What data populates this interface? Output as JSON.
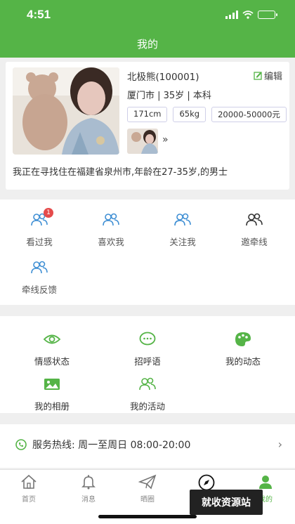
{
  "status_bar": {
    "time": "4:51"
  },
  "header": {
    "title": "我的"
  },
  "profile": {
    "name": "北极熊(100001)",
    "edit_label": "编辑",
    "info": "厦门市 | 35岁 | 本科",
    "tags": [
      "171cm",
      "65kg",
      "20000-50000元"
    ],
    "more": "»",
    "description": "我正在寻找住在福建省泉州市,年龄在27-35岁,的男士"
  },
  "quick_actions": [
    {
      "label": "看过我",
      "icon": "users-icon",
      "badge": "1"
    },
    {
      "label": "喜欢我",
      "icon": "users-icon"
    },
    {
      "label": "关注我",
      "icon": "users-icon"
    },
    {
      "label": "邀牵线",
      "icon": "users-icon"
    },
    {
      "label": "牵线反馈",
      "icon": "users-icon"
    }
  ],
  "features": [
    {
      "label": "情感状态",
      "icon": "eye-icon"
    },
    {
      "label": "招呼语",
      "icon": "chat-bubble-icon"
    },
    {
      "label": "我的动态",
      "icon": "palette-icon"
    },
    {
      "label": "我的相册",
      "icon": "photo-icon"
    },
    {
      "label": "我的活动",
      "icon": "users-icon"
    }
  ],
  "hotline": {
    "text": "服务热线: 周一至周日 08:00-20:00",
    "icon": "phone-icon"
  },
  "tabbar": [
    {
      "label": "首页",
      "icon": "home-icon"
    },
    {
      "label": "消息",
      "icon": "bell-icon"
    },
    {
      "label": "晒圈",
      "icon": "paper-plane-icon"
    },
    {
      "label": "",
      "icon": "compass-icon"
    },
    {
      "label": "我的",
      "icon": "user-icon"
    }
  ],
  "watermark": "就收资源站",
  "colors": {
    "brand": "#55b447",
    "accent_icon": "#3f8fd4",
    "badge": "#e54b4b"
  }
}
